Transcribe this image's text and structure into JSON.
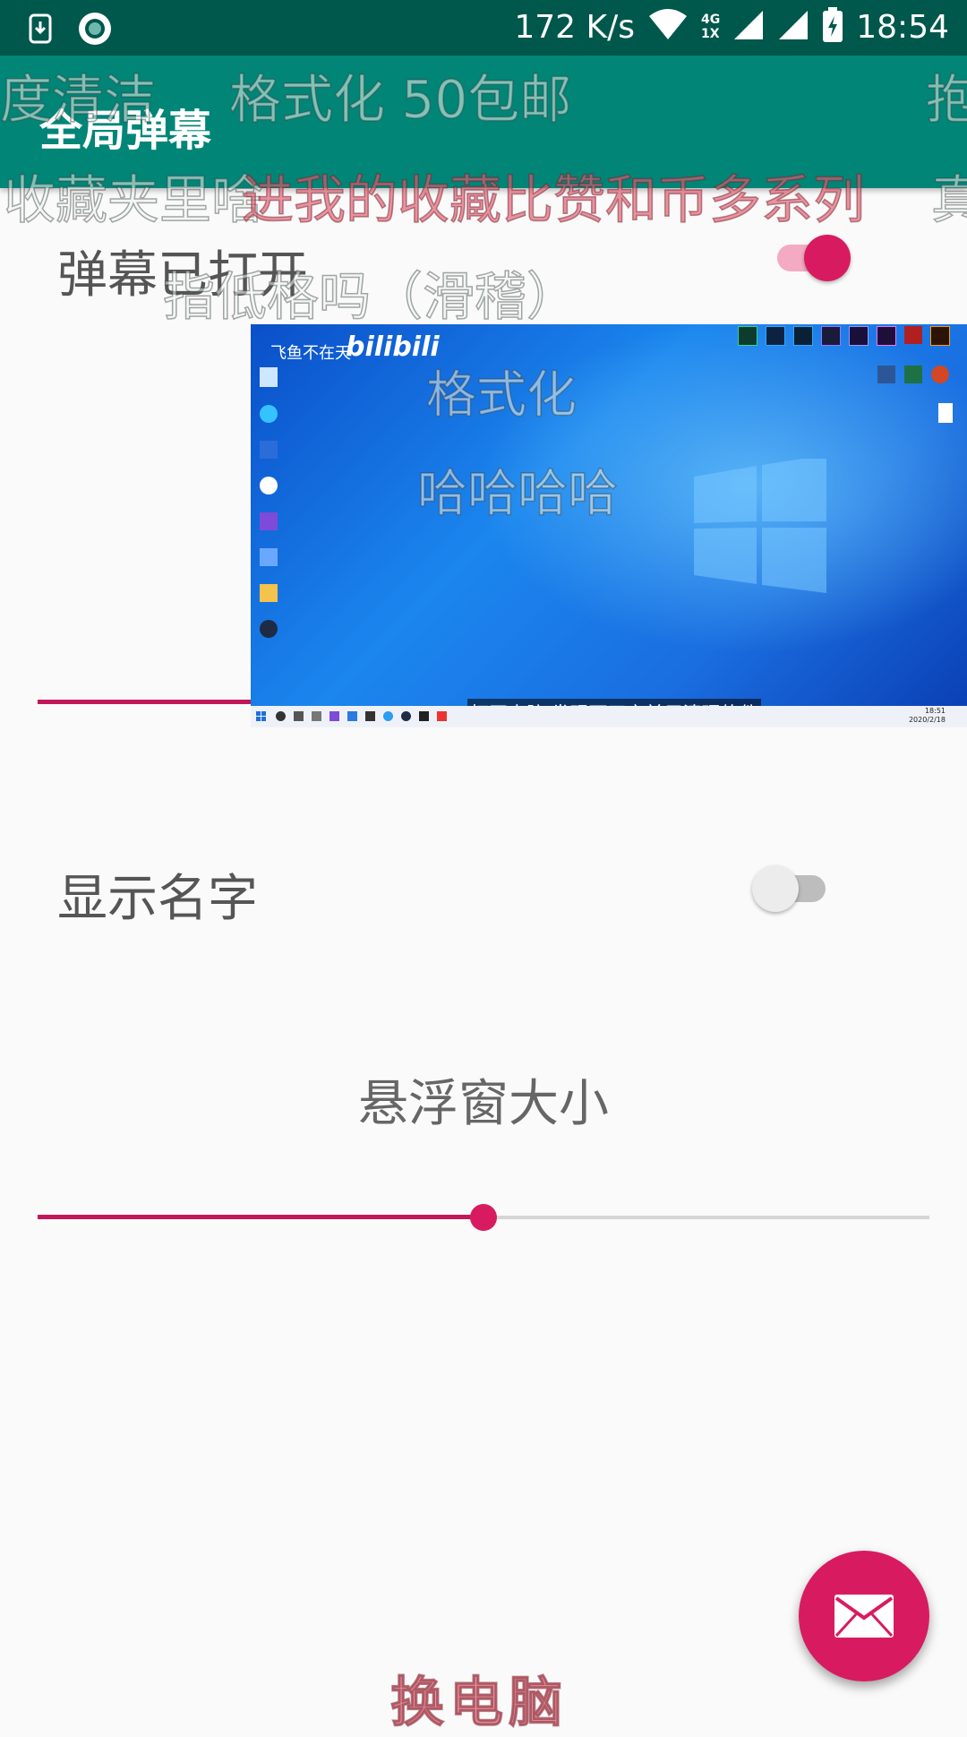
{
  "status_bar": {
    "speed": "172 K/s",
    "network_badge": "4G",
    "network_sub": "1X",
    "time": "18:54",
    "icons": [
      "download-notification-icon",
      "record-icon",
      "wifi-icon",
      "signal-icon",
      "battery-charging-icon"
    ]
  },
  "app_bar": {
    "title": "全局弹幕"
  },
  "settings": {
    "danmaku_toggle": {
      "label": "弹幕已打开",
      "on": true
    },
    "show_name_toggle": {
      "label": "显示名字",
      "on": false
    },
    "window_size": {
      "label": "悬浮窗大小",
      "value_fraction": 0.5
    },
    "hidden_slider": {
      "value_fraction": 0.3
    }
  },
  "video_overlay": {
    "channel": "飞鱼不在天",
    "brand": "bilibili",
    "subtitle": "打开电脑 发现两天之前用清理软件",
    "danmaku": [
      "格式化",
      "哈哈哈哈"
    ],
    "taskbar_date": "2020/2/18",
    "taskbar_time": "18:51"
  },
  "floating_danmaku": [
    "度清洁",
    "格式化 50包邮",
    "抱",
    "收藏夹里啥",
    "进我的收藏比赞和币多系列",
    "真",
    "指低格吗（滑稽）",
    "换电脑"
  ],
  "colors": {
    "primary": "#008577",
    "primary_dark": "#00574b",
    "accent": "#d81b60",
    "background": "#fafafa"
  },
  "fab": {
    "icon": "mail-icon"
  }
}
